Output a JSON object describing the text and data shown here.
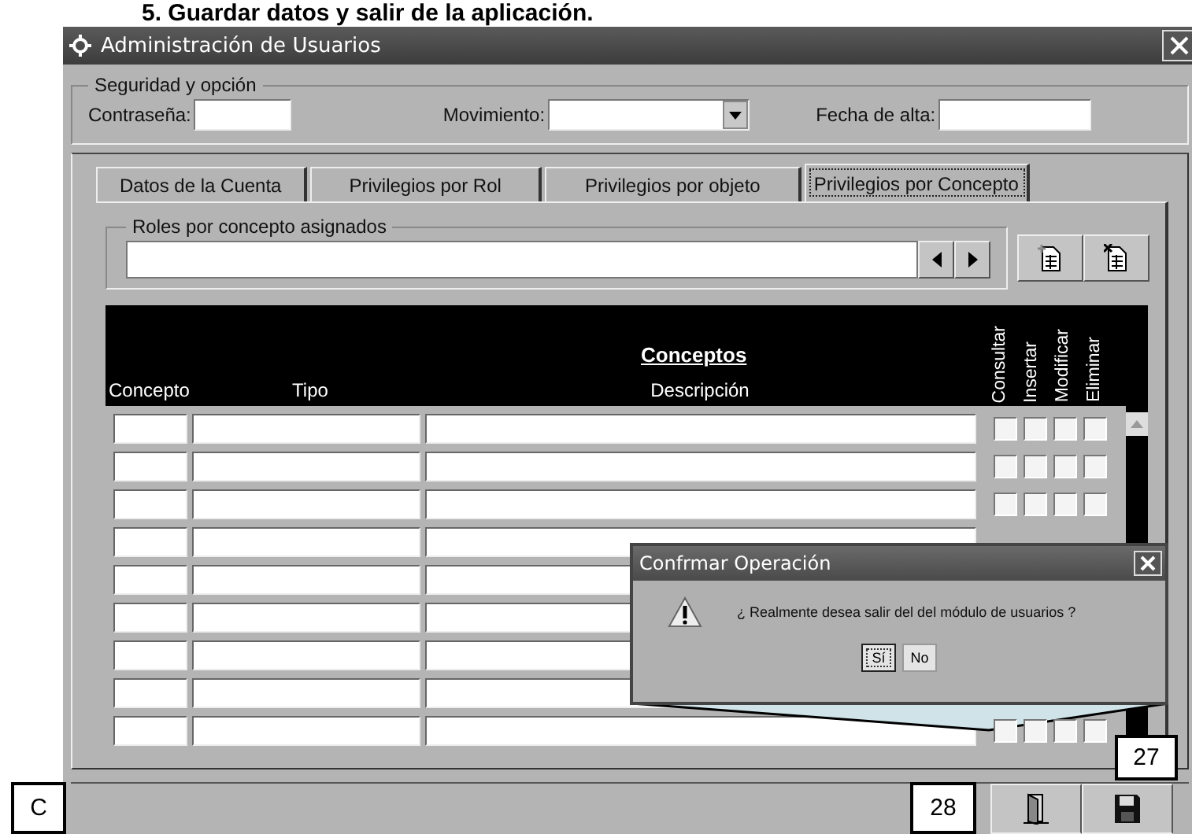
{
  "heading": "5. Guardar datos y salir de la aplicación.",
  "window": {
    "title": "Administración de Usuarios"
  },
  "security": {
    "legend": "Seguridad y opción",
    "fields": [
      {
        "label": "Contraseña:",
        "kind": "text"
      },
      {
        "label": "Movimiento:",
        "kind": "select"
      },
      {
        "label": "Fecha de alta:",
        "kind": "text"
      }
    ]
  },
  "tabs": [
    {
      "label": "Datos de la Cuenta",
      "selected": false
    },
    {
      "label": "Privilegios por Rol",
      "selected": false
    },
    {
      "label": "Privilegios por objeto",
      "selected": false
    },
    {
      "label": "Privilegios por Concepto",
      "selected": true
    }
  ],
  "roles": {
    "legend": "Roles por concepto asignados"
  },
  "table": {
    "title": "Conceptos",
    "columns": [
      "Concepto",
      "Tipo",
      "Descripción"
    ],
    "permission_columns": [
      "Consultar",
      "Insertar",
      "Modificar",
      "Eliminar"
    ],
    "rows": [
      {
        "checks": [
          false,
          false,
          false,
          false
        ]
      },
      {
        "checks": [
          false,
          false,
          false,
          false
        ]
      },
      {
        "checks": [
          false,
          false,
          false,
          false
        ]
      },
      {},
      {},
      {},
      {},
      {},
      {
        "checks": [
          false,
          false,
          false,
          false
        ]
      }
    ]
  },
  "dialog": {
    "title": "Confrmar Operación",
    "message": "¿ Realmente desea salir del del módulo de usuarios ?",
    "buttons": [
      {
        "label": "Sí",
        "selected": true
      },
      {
        "label": "No",
        "selected": false
      }
    ]
  },
  "callouts": {
    "dialog": "27",
    "exit": "28",
    "corner": "C"
  }
}
